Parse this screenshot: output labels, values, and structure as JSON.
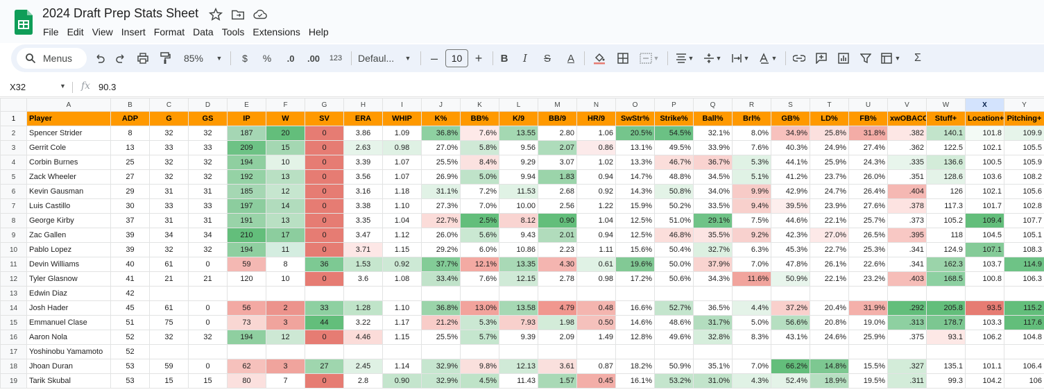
{
  "app": {
    "title": "2024 Draft Prep Stats Sheet",
    "menus": [
      "File",
      "Edit",
      "View",
      "Insert",
      "Format",
      "Data",
      "Tools",
      "Extensions",
      "Help"
    ]
  },
  "toolbar": {
    "search_label": "Menus",
    "zoom": "85%",
    "currency": "$",
    "percent": "%",
    "dec_decrease": ".0",
    "dec_increase": ".00",
    "number_format": "123",
    "font": "Defaul...",
    "font_size": "10",
    "minus": "–",
    "plus": "+",
    "bold": "B",
    "italic": "I",
    "strike": "S",
    "text_color": "A",
    "sigma": "Σ"
  },
  "formula": {
    "cell": "X32",
    "fx": "fx",
    "value": "90.3"
  },
  "grid": {
    "selected_col": "X",
    "columns": [
      "A",
      "B",
      "C",
      "D",
      "E",
      "F",
      "G",
      "H",
      "I",
      "J",
      "K",
      "L",
      "M",
      "N",
      "O",
      "P",
      "Q",
      "R",
      "S",
      "T",
      "U",
      "V",
      "W",
      "X",
      "Y"
    ],
    "header": [
      "Player",
      "ADP",
      "G",
      "GS",
      "IP",
      "W",
      "SV",
      "ERA",
      "WHIP",
      "K%",
      "BB%",
      "K/9",
      "BB/9",
      "HR/9",
      "SwStr%",
      "Strike%",
      "Ball%",
      "Brl%",
      "GB%",
      "LD%",
      "FB%",
      "xwOBACON",
      "Stuff+",
      "Location+",
      "Pitching+"
    ],
    "rows": [
      {
        "n": "2",
        "c": [
          "Spencer Strider",
          "8",
          "32",
          "32",
          "187",
          "20",
          "0",
          "3.86",
          "1.09",
          "36.8%",
          "7.6%",
          "13.55",
          "2.80",
          "1.06",
          "20.5%",
          "54.5%",
          "32.1%",
          "8.0%",
          "34.9%",
          "25.8%",
          "31.8%",
          ".382",
          "140.1",
          "101.8",
          "109.9"
        ],
        "bg": [
          "",
          "",
          "",
          "",
          "#a5d6b4",
          "#63be7b",
          "#e67c73",
          "#fff",
          "#fff",
          "#8ed0a1",
          "#fde9e8",
          "#a4d8b2",
          "#fff",
          "#fff",
          "#75c58c",
          "#6bc184",
          "#fff",
          "#fff",
          "#f7c1bd",
          "#fbe0de",
          "#f3aca6",
          "#fde7e5",
          "#c2e4cb",
          "#f3faf5",
          "#e6f4ea"
        ]
      },
      {
        "n": "3",
        "c": [
          "Gerrit Cole",
          "13",
          "33",
          "33",
          "209",
          "15",
          "0",
          "2.63",
          "0.98",
          "27.0%",
          "5.8%",
          "9.56",
          "2.07",
          "0.86",
          "13.1%",
          "49.5%",
          "33.9%",
          "7.6%",
          "40.3%",
          "24.9%",
          "27.4%",
          ".362",
          "122.5",
          "102.1",
          "105.5"
        ],
        "bg": [
          "",
          "",
          "",
          "",
          "#6dc285",
          "#a4d7b2",
          "#e67c73",
          "#e6f4ea",
          "#dff1e4",
          "#fff",
          "#cfe9d6",
          "#fff",
          "#aedcbb",
          "#fceaea",
          "#fff",
          "#fff",
          "#fff",
          "#fff",
          "#fff",
          "#fff",
          "#fff",
          "#fff",
          "#fff",
          "#fff",
          "#fff"
        ]
      },
      {
        "n": "4",
        "c": [
          "Corbin Burnes",
          "25",
          "32",
          "32",
          "194",
          "10",
          "0",
          "3.39",
          "1.07",
          "25.5%",
          "8.4%",
          "9.29",
          "3.07",
          "1.02",
          "13.3%",
          "46.7%",
          "36.7%",
          "5.3%",
          "44.1%",
          "25.9%",
          "24.3%",
          ".335",
          "136.6",
          "100.5",
          "105.9"
        ],
        "bg": [
          "",
          "",
          "",
          "",
          "#8fcfa0",
          "#e3f3e7",
          "#e67c73",
          "#fff",
          "#fff",
          "#fff",
          "#fbe2e0",
          "#fff",
          "#fff",
          "#fff",
          "#fff",
          "#fbdedb",
          "#f9d3d0",
          "#e0f2e5",
          "#fff",
          "#fff",
          "#fff",
          "#e8f5ec",
          "#d3ecd9",
          "#fff",
          "#fff"
        ]
      },
      {
        "n": "5",
        "c": [
          "Zack Wheeler",
          "27",
          "32",
          "32",
          "192",
          "13",
          "0",
          "3.56",
          "1.07",
          "26.9%",
          "5.0%",
          "9.94",
          "1.83",
          "0.94",
          "14.7%",
          "48.8%",
          "34.5%",
          "5.1%",
          "41.2%",
          "23.7%",
          "26.0%",
          ".351",
          "128.6",
          "103.6",
          "108.2"
        ],
        "bg": [
          "",
          "",
          "",
          "",
          "#95d2a5",
          "#b9e0c3",
          "#e67c73",
          "#fff",
          "#fff",
          "#fff",
          "#bfe3c9",
          "#fff",
          "#9bd4aa",
          "#fff",
          "#fff",
          "#fff",
          "#fff",
          "#e0f2e5",
          "#fff",
          "#fff",
          "#fff",
          "#fff",
          "#e4f3e8",
          "#fff",
          "#fff"
        ]
      },
      {
        "n": "6",
        "c": [
          "Kevin Gausman",
          "29",
          "31",
          "31",
          "185",
          "12",
          "0",
          "3.16",
          "1.18",
          "31.1%",
          "7.2%",
          "11.53",
          "2.68",
          "0.92",
          "14.3%",
          "50.8%",
          "34.0%",
          "9.9%",
          "42.9%",
          "24.7%",
          "26.4%",
          ".404",
          "126",
          "102.1",
          "105.6"
        ],
        "bg": [
          "",
          "",
          "",
          "",
          "#a5d7b3",
          "#c6e6cf",
          "#e67c73",
          "#fff",
          "#fff",
          "#e1f2e6",
          "#fff",
          "#e0f2e5",
          "#fff",
          "#fff",
          "#fff",
          "#e3f3e7",
          "#fff",
          "#f7cbc7",
          "#fff",
          "#fff",
          "#fff",
          "#f5b8b3",
          "#fff",
          "#fff",
          "#fff"
        ]
      },
      {
        "n": "7",
        "c": [
          "Luis Castillo",
          "30",
          "33",
          "33",
          "197",
          "14",
          "0",
          "3.38",
          "1.10",
          "27.3%",
          "7.0%",
          "10.00",
          "2.56",
          "1.22",
          "15.9%",
          "50.2%",
          "33.5%",
          "9.4%",
          "39.5%",
          "23.9%",
          "27.6%",
          ".378",
          "117.3",
          "101.7",
          "102.8"
        ],
        "bg": [
          "",
          "",
          "",
          "",
          "#8ccd9e",
          "#b1dcbd",
          "#e67c73",
          "#fff",
          "#fff",
          "#fff",
          "#fff",
          "#fff",
          "#fff",
          "#fff",
          "#fff",
          "#fff",
          "#fff",
          "#f8d0cc",
          "#fdeeed",
          "#fff",
          "#fff",
          "#fde3e1",
          "#fff",
          "#fff",
          "#fff"
        ]
      },
      {
        "n": "8",
        "c": [
          "George Kirby",
          "37",
          "31",
          "31",
          "191",
          "13",
          "0",
          "3.35",
          "1.04",
          "22.7%",
          "2.5%",
          "8.12",
          "0.90",
          "1.04",
          "12.5%",
          "51.0%",
          "29.1%",
          "7.5%",
          "44.6%",
          "22.1%",
          "25.7%",
          ".373",
          "105.2",
          "109.4",
          "107.7"
        ],
        "bg": [
          "",
          "",
          "",
          "",
          "#99d3a8",
          "#b9e0c3",
          "#e67c73",
          "#fff",
          "#fff",
          "#fbdcd9",
          "#63be7b",
          "#f9d4d1",
          "#63be7b",
          "#fff",
          "#fff",
          "#fff",
          "#6fc387",
          "#fff",
          "#fff",
          "#fff",
          "#fff",
          "#fff",
          "#fff",
          "#63be7b",
          "#fff"
        ]
      },
      {
        "n": "9",
        "c": [
          "Zac Gallen",
          "39",
          "34",
          "34",
          "210",
          "17",
          "0",
          "3.47",
          "1.12",
          "26.0%",
          "5.6%",
          "9.43",
          "2.01",
          "0.94",
          "12.5%",
          "46.8%",
          "35.5%",
          "9.2%",
          "42.3%",
          "27.0%",
          "26.5%",
          ".395",
          "118",
          "104.5",
          "105.1"
        ],
        "bg": [
          "",
          "",
          "",
          "",
          "#63be7b",
          "#8ccd9e",
          "#e67c73",
          "#fff",
          "#fff",
          "#fff",
          "#cae8d2",
          "#fff",
          "#b1dcbc",
          "#fff",
          "#fff",
          "#fbdedb",
          "#fce5e3",
          "#f8d1ce",
          "#fff",
          "#fde9e8",
          "#fff",
          "#f8c8c4",
          "#fff",
          "#fff",
          "#fff"
        ]
      },
      {
        "n": "10",
        "c": [
          "Pablo Lopez",
          "39",
          "32",
          "32",
          "194",
          "11",
          "0",
          "3.71",
          "1.15",
          "29.2%",
          "6.0%",
          "10.86",
          "2.23",
          "1.11",
          "15.6%",
          "50.4%",
          "32.7%",
          "6.3%",
          "45.3%",
          "22.7%",
          "25.3%",
          ".341",
          "124.9",
          "107.1",
          "108.3"
        ],
        "bg": [
          "",
          "",
          "",
          "",
          "#8fcfa0",
          "#d4ede0",
          "#e67c73",
          "#fde7e6",
          "#fff",
          "#fff",
          "#fff",
          "#fff",
          "#fff",
          "#fff",
          "#fff",
          "#fff",
          "#dcf0e1",
          "#fff",
          "#fff",
          "#fff",
          "#fff",
          "#fff",
          "#fff",
          "#85cb98",
          "#fff"
        ]
      },
      {
        "n": "11",
        "c": [
          "Devin Williams",
          "40",
          "61",
          "0",
          "59",
          "8",
          "36",
          "1.53",
          "0.92",
          "37.7%",
          "12.1%",
          "13.35",
          "4.30",
          "0.61",
          "19.6%",
          "50.0%",
          "37.9%",
          "7.0%",
          "47.8%",
          "26.1%",
          "22.6%",
          ".341",
          "162.3",
          "103.7",
          "114.9"
        ],
        "bg": [
          "",
          "",
          "",
          "",
          "#f4b8b3",
          "#fff",
          "#7dc993",
          "#c6e6ce",
          "#cde9d5",
          "#83cc97",
          "#f3aaa3",
          "#a9d9b6",
          "#f4b5b0",
          "#e0f2e5",
          "#82c995",
          "#fff",
          "#f9d4d0",
          "#fff",
          "#fff",
          "#fff",
          "#fff",
          "#fff",
          "#9bd4aa",
          "#fff",
          "#6ec386"
        ]
      },
      {
        "n": "12",
        "c": [
          "Tyler Glasnow",
          "41",
          "21",
          "21",
          "120",
          "10",
          "0",
          "3.6",
          "1.08",
          "33.4%",
          "7.6%",
          "12.15",
          "2.78",
          "0.98",
          "17.2%",
          "50.6%",
          "34.3%",
          "11.6%",
          "50.9%",
          "22.1%",
          "23.2%",
          ".403",
          "168.5",
          "100.8",
          "106.3"
        ],
        "bg": [
          "",
          "",
          "",
          "",
          "#fff",
          "#fff",
          "#e67c73",
          "#fff",
          "#fff",
          "#c1e3ca",
          "#fff",
          "#d0ead7",
          "#fff",
          "#fff",
          "#fff",
          "#fff",
          "#fff",
          "#f1a49d",
          "#e8f5ec",
          "#fff",
          "#fff",
          "#f6bdb8",
          "#8dd0a1",
          "#fff",
          "#fff"
        ]
      },
      {
        "n": "13",
        "c": [
          "Edwin Diaz",
          "42",
          "",
          "",
          "",
          "",
          "",
          "",
          "",
          "",
          "",
          "",
          "",
          "",
          "",
          "",
          "",
          "",
          "",
          "",
          "",
          "",
          "",
          "",
          ""
        ],
        "bg": [
          "",
          "",
          "",
          "",
          "",
          "",
          "",
          "",
          "",
          "",
          "",
          "",
          "",
          "",
          "",
          "",
          "",
          "",
          "",
          "",
          "",
          "",
          "",
          "",
          ""
        ]
      },
      {
        "n": "14",
        "c": [
          "Josh Hader",
          "45",
          "61",
          "0",
          "56",
          "2",
          "33",
          "1.28",
          "1.10",
          "36.8%",
          "13.0%",
          "13.58",
          "4.79",
          "0.48",
          "16.6%",
          "52.7%",
          "36.5%",
          "4.4%",
          "37.2%",
          "20.4%",
          "31.9%",
          ".292",
          "205.8",
          "93.5",
          "115.2"
        ],
        "bg": [
          "",
          "",
          "",
          "",
          "#f3a9a3",
          "#ec938c",
          "#8ed0a1",
          "#c0e4c9",
          "#fff",
          "#9bd4aa",
          "#f2a39c",
          "#a6d8b4",
          "#f0978f",
          "#f4b5af",
          "#fff",
          "#c4e5cd",
          "#fff",
          "#e4f3e8",
          "#f9d0cc",
          "#fff",
          "#f4b0aa",
          "#63be7b",
          "#63be7b",
          "#e67c73",
          "#63be7b"
        ]
      },
      {
        "n": "15",
        "c": [
          "Emmanuel Clase",
          "51",
          "75",
          "0",
          "73",
          "3",
          "44",
          "3.22",
          "1.17",
          "21.2%",
          "5.3%",
          "7.93",
          "1.98",
          "0.50",
          "14.6%",
          "48.6%",
          "31.7%",
          "5.0%",
          "56.6%",
          "20.8%",
          "19.0%",
          ".313",
          "178.7",
          "103.3",
          "117.6"
        ],
        "bg": [
          "",
          "",
          "",
          "",
          "#f9d7d3",
          "#f0a49d",
          "#63be7b",
          "#fff",
          "#fff",
          "#f8ccc8",
          "#cbe8d3",
          "#f8d0cc",
          "#d3ecd9",
          "#f5c1bc",
          "#fff",
          "#fff",
          "#b3ddbf",
          "#fff",
          "#b6dfc1",
          "#fff",
          "#fff",
          "#8ed0a1",
          "#7cc791",
          "#fff",
          "#63be7b"
        ]
      },
      {
        "n": "16",
        "c": [
          "Aaron Nola",
          "52",
          "32",
          "32",
          "194",
          "12",
          "0",
          "4.46",
          "1.15",
          "25.5%",
          "5.7%",
          "9.39",
          "2.09",
          "1.49",
          "12.8%",
          "49.6%",
          "32.8%",
          "8.3%",
          "43.1%",
          "24.6%",
          "25.9%",
          ".375",
          "93.1",
          "106.2",
          "104.8"
        ],
        "bg": [
          "",
          "",
          "",
          "",
          "#8fcfa0",
          "#cde8d4",
          "#e67c73",
          "#fbdcd9",
          "#fff",
          "#fff",
          "#c5e6ce",
          "#fff",
          "#fff",
          "#fff",
          "#fff",
          "#fff",
          "#d6eedc",
          "#fff",
          "#fff",
          "#fff",
          "#fff",
          "#fff",
          "#fde8e6",
          "#fff",
          "#fff"
        ]
      },
      {
        "n": "17",
        "c": [
          "Yoshinobu Yamamoto",
          "52",
          "",
          "",
          "",
          "",
          "",
          "",
          "",
          "",
          "",
          "",
          "",
          "",
          "",
          "",
          "",
          "",
          "",
          "",
          "",
          "",
          "",
          "",
          ""
        ],
        "bg": [
          "",
          "",
          "",
          "",
          "",
          "",
          "",
          "",
          "",
          "",
          "",
          "",
          "",
          "",
          "",
          "",
          "",
          "",
          "",
          "",
          "",
          "",
          "",
          "",
          ""
        ]
      },
      {
        "n": "18",
        "c": [
          "Jhoan Duran",
          "53",
          "59",
          "0",
          "62",
          "3",
          "27",
          "2.45",
          "1.14",
          "32.9%",
          "9.8%",
          "12.13",
          "3.61",
          "0.87",
          "18.2%",
          "50.9%",
          "35.1%",
          "7.0%",
          "66.2%",
          "14.8%",
          "15.5%",
          ".327",
          "135.1",
          "101.1",
          "106.4"
        ],
        "bg": [
          "",
          "",
          "",
          "",
          "#f6c1bc",
          "#f0a49d",
          "#9fd6ae",
          "#dff1e4",
          "#fff",
          "#c6e6cf",
          "#fae0dd",
          "#d0ead7",
          "#fae0dd",
          "#fff",
          "#fff",
          "#fff",
          "#fff",
          "#fff",
          "#63be7b",
          "#7dc891",
          "#fff",
          "#d3ecd9",
          "#fff",
          "#fff",
          "#fff"
        ]
      },
      {
        "n": "19",
        "c": [
          "Tarik Skubal",
          "53",
          "15",
          "15",
          "80",
          "7",
          "0",
          "2.8",
          "0.90",
          "32.9%",
          "4.5%",
          "11.43",
          "1.57",
          "0.45",
          "16.1%",
          "53.2%",
          "31.0%",
          "4.3%",
          "52.4%",
          "18.9%",
          "19.5%",
          ".311",
          "99.3",
          "104.2",
          "106"
        ],
        "bg": [
          "",
          "",
          "",
          "",
          "#fbe0de",
          "#fff",
          "#e67c73",
          "#fff",
          "#c4e5cd",
          "#c6e6cf",
          "#bfe3c8",
          "#fff",
          "#a9d9b6",
          "#f3aea8",
          "#fff",
          "#c4e5cd",
          "#c2e4cb",
          "#e0f2e5",
          "#e4f3e8",
          "#b6dfc1",
          "#fff",
          "#d3ecd9",
          "#fff",
          "#fff",
          "#fff"
        ]
      }
    ]
  }
}
